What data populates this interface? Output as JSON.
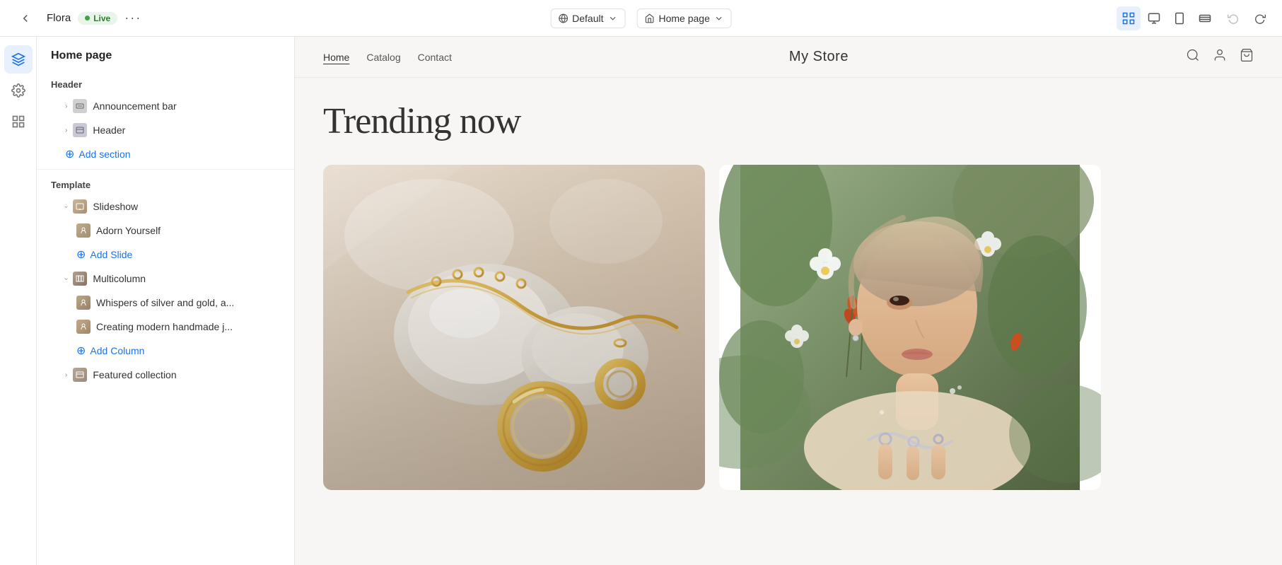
{
  "app": {
    "name": "Flora",
    "live_label": "Live",
    "more_icon": "···"
  },
  "topbar": {
    "default_label": "Default",
    "homepage_label": "Home page",
    "chevron": "▾"
  },
  "sidebar": {
    "title": "Home page",
    "sections": [
      {
        "label": "Header",
        "items": [
          {
            "name": "Announcement bar",
            "type": "bar",
            "indent": 1,
            "expandable": true
          },
          {
            "name": "Header",
            "type": "header-ic",
            "indent": 1,
            "expandable": true
          }
        ],
        "add_label": "Add section"
      },
      {
        "label": "Template",
        "items": [
          {
            "name": "Slideshow",
            "type": "slideshow",
            "indent": 1,
            "expandable": true,
            "expanded": true
          },
          {
            "name": "Adorn Yourself",
            "type": "adorn",
            "indent": 2,
            "expandable": false
          },
          {
            "name": "Multicolumn",
            "type": "multicolumn",
            "indent": 1,
            "expandable": true,
            "expanded": true
          },
          {
            "name": "Whispers of silver and gold, a...",
            "type": "whisper",
            "indent": 2,
            "expandable": false
          },
          {
            "name": "Creating modern handmade j...",
            "type": "creating",
            "indent": 2,
            "expandable": false
          },
          {
            "name": "Featured collection",
            "type": "featured",
            "indent": 1,
            "expandable": true
          }
        ],
        "add_slide_label": "Add Slide",
        "add_column_label": "Add Column"
      }
    ]
  },
  "store": {
    "nav_links": [
      {
        "label": "Home",
        "active": true
      },
      {
        "label": "Catalog",
        "active": false
      },
      {
        "label": "Contact",
        "active": false
      }
    ],
    "name": "My Store"
  },
  "hero": {
    "title": "Trending now"
  },
  "cards": [
    {
      "type": "jewelry",
      "alt": "Gold jewelry on stone background"
    },
    {
      "type": "woman",
      "alt": "Woman with flowers and silver rings"
    }
  ],
  "colors": {
    "accent_blue": "#1a73e8",
    "live_green": "#43a047",
    "live_bg": "#e8f5e9"
  },
  "icons": {
    "search": "🔍",
    "user": "👤",
    "cart": "🛒",
    "undo": "↩",
    "redo": "↪",
    "globe": "🌐",
    "home": "⌂",
    "layers": "⊞",
    "settings": "⚙",
    "grid": "⊟"
  }
}
